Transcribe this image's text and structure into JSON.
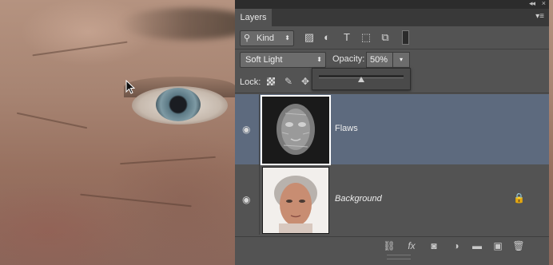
{
  "panel": {
    "tab_label": "Layers",
    "collapse_glyph": "◂◂",
    "close_glyph": "×",
    "menu_glyph": "▾≡"
  },
  "filter": {
    "kind_label": "Kind",
    "search_glyph": "⚲",
    "arrow_glyph": "⬍",
    "icons": [
      "image-filter-icon",
      "adjustment-filter-icon",
      "type-filter-icon",
      "shape-filter-icon",
      "smart-object-filter-icon"
    ],
    "glyphs": [
      "▨",
      "◐",
      "T",
      "⬚",
      "⧉"
    ]
  },
  "blend": {
    "mode": "Soft Light",
    "arrow_glyph": "⬍",
    "opacity_label": "Opacity:",
    "opacity_value": "50%",
    "dropdown_glyph": "▾",
    "opacity_fraction": 0.5
  },
  "lock": {
    "label": "Lock:",
    "brush_glyph": "✎",
    "move_glyph": "✥"
  },
  "layers": [
    {
      "name": "Flaws",
      "selected": true,
      "eye_glyph": "◉"
    },
    {
      "name": "Background",
      "selected": false,
      "eye_glyph": "◉",
      "lock_glyph": "🔒"
    }
  ],
  "bottom_bar": {
    "icons": [
      "link-layers-icon",
      "fx-icon",
      "add-mask-icon",
      "new-adjustment-icon",
      "new-group-icon",
      "new-layer-icon",
      "delete-layer-icon"
    ],
    "glyphs": [
      "⛓",
      "fx",
      "◙",
      "◑",
      "▬",
      "▣",
      "🗑"
    ]
  }
}
